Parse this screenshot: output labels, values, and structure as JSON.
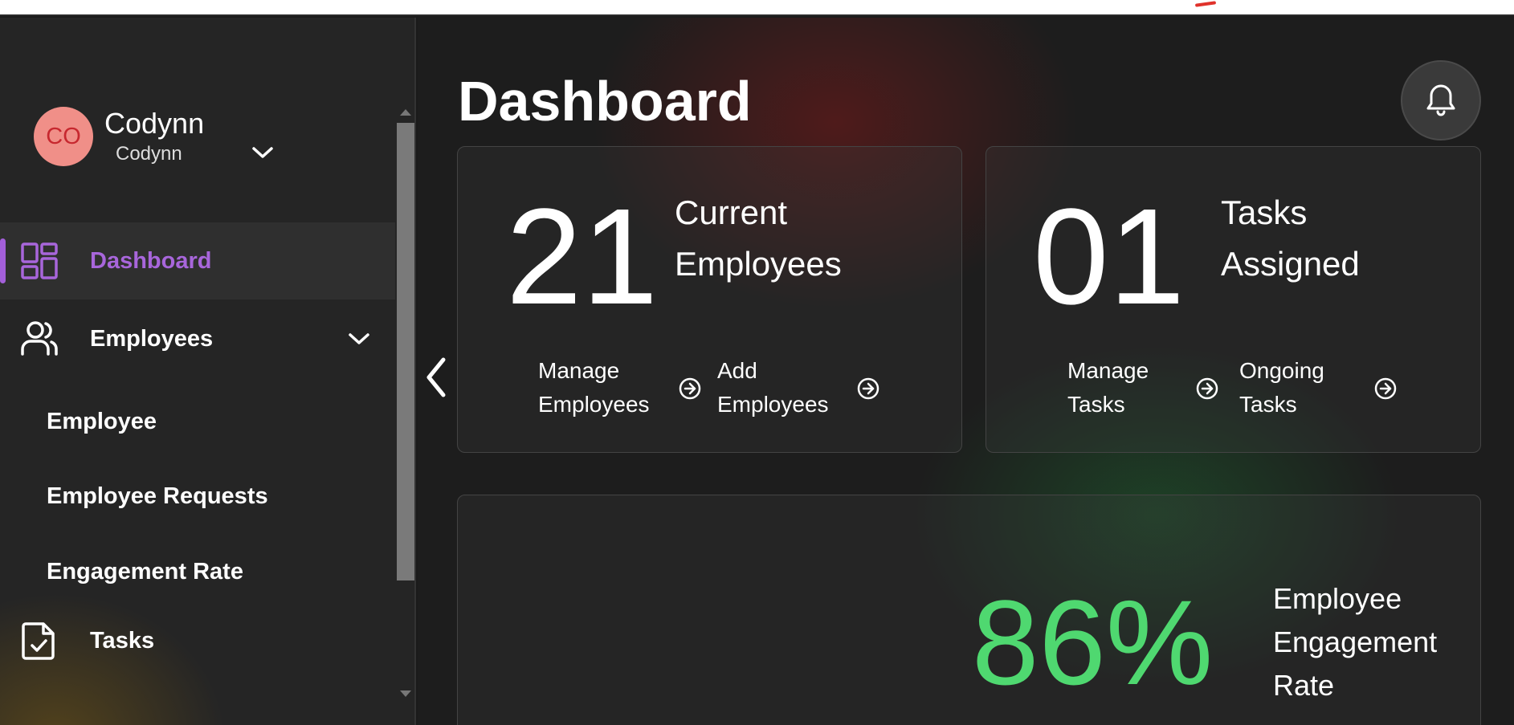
{
  "user": {
    "initials": "CO",
    "name": "Codynn",
    "username": "Codynn"
  },
  "sidebar": {
    "items": [
      {
        "label": "Dashboard",
        "icon": "grid-icon",
        "active": true
      },
      {
        "label": "Employees",
        "icon": "users-icon",
        "expanded": true
      },
      {
        "label": "Tasks",
        "icon": "task-file-icon"
      }
    ],
    "employees_sub": [
      "Employee",
      "Employee Requests",
      "Engagement Rate"
    ]
  },
  "page": {
    "title": "Dashboard"
  },
  "cards": {
    "employees": {
      "value": "21",
      "label": "Current Employees",
      "links": [
        "Manage Employees",
        "Add Employees"
      ]
    },
    "tasks": {
      "value": "01",
      "label": "Tasks Assigned",
      "links": [
        "Manage Tasks",
        "Ongoing Tasks"
      ]
    },
    "engagement": {
      "value": "86%",
      "label": "Employee Engagement Rate"
    }
  },
  "colors": {
    "accent_active": "#a866db",
    "engagement_green": "#4fd870",
    "avatar_bg": "#f08f88",
    "avatar_text": "#c7282f"
  }
}
